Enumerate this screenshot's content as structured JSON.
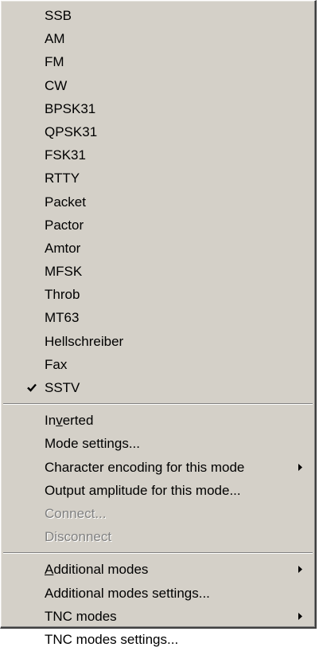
{
  "menu": {
    "modes": [
      {
        "label": "SSB"
      },
      {
        "label": "AM"
      },
      {
        "label": "FM"
      },
      {
        "label": "CW"
      },
      {
        "label": "BPSK31"
      },
      {
        "label": "QPSK31"
      },
      {
        "label": "FSK31"
      },
      {
        "label": "RTTY"
      },
      {
        "label": "Packet"
      },
      {
        "label": "Pactor"
      },
      {
        "label": "Amtor"
      },
      {
        "label": "MFSK"
      },
      {
        "label": "Throb"
      },
      {
        "label": "MT63"
      },
      {
        "label": "Hellschreiber"
      },
      {
        "label": "Fax"
      },
      {
        "label": "SSTV",
        "checked": true
      }
    ],
    "options": {
      "inverted_pre": "In",
      "inverted_mnemonic": "v",
      "inverted_post": "erted",
      "mode_settings": "Mode settings...",
      "character_encoding": "Character encoding for this mode",
      "output_amplitude": "Output amplitude for this mode...",
      "connect": "Connect...",
      "disconnect": "Disconnect"
    },
    "extra": {
      "additional_modes_mnemonic": "A",
      "additional_modes_rest": "dditional modes",
      "additional_modes_settings": "Additional modes settings...",
      "tnc_modes": "TNC modes",
      "tnc_modes_settings": "TNC modes settings..."
    },
    "icons": {
      "check": "checkmark-icon",
      "submenu": "submenu-arrow-icon"
    },
    "colors": {
      "background": "#d4d0c8",
      "text": "#000000",
      "disabled_text": "#808080"
    }
  }
}
